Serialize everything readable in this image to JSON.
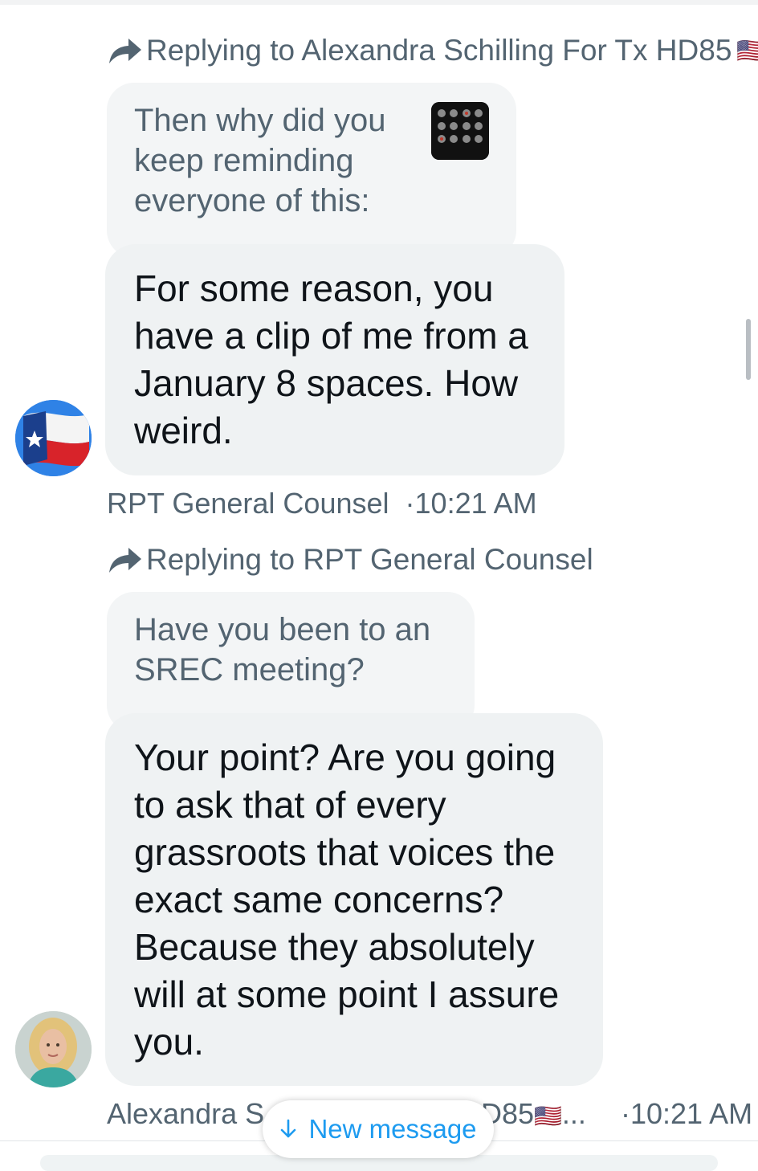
{
  "thread": [
    {
      "reply_label": "Replying to Alexandra Schilling For Tx HD85",
      "reply_flag": "🇺🇸",
      "quoted_text": "Then why did you keep reminding everyone of this:",
      "message_text": "For some reason, you have a clip of me from a January 8 spaces. How weird.",
      "sender": "RPT General Counsel",
      "time": "·10:21 AM"
    },
    {
      "reply_label": "Replying to RPT General Counsel",
      "quoted_text": "Have you been to an SREC meeting?",
      "message_text": "Your point?  Are you going to ask that of every grassroots that voices the exact same concerns? Because they absolutely will at some point I assure you.",
      "sender_partial_left": "Alexandra S",
      "sender_partial_right": "D85",
      "sender_flag": "🇺🇸",
      "sender_ellipsis": "...",
      "time": "·10:21 AM"
    }
  ],
  "new_message_pill": {
    "label": "New message",
    "icon": "arrow-down-icon"
  },
  "icons": [
    "reply-arrow-icon",
    "texas-flag-avatar",
    "profile-photo-avatar",
    "media-thumbnail"
  ],
  "colors": {
    "accent": "#1d9bf0",
    "secondary_text": "#536471",
    "bubble_bg": "#eff2f3"
  }
}
